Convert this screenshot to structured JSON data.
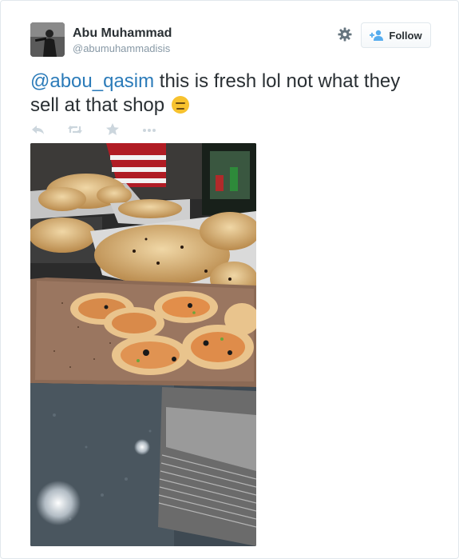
{
  "user": {
    "display_name": "Abu Muhammad",
    "handle": "@abumuhammadisis",
    "avatar_icon": "profile-photo"
  },
  "follow_button": {
    "label": "Follow",
    "icon": "add-user-icon"
  },
  "tweet": {
    "mention": "@abou_qasim",
    "text_line1": " this is fresh lol not what they",
    "text_line2": "sell at that shop",
    "emoji": "expressionless-face-emoji"
  },
  "actions": [
    "reply-icon",
    "retweet-icon",
    "favorite-icon",
    "more-icon"
  ],
  "colors": {
    "mention": "#2b7bb9",
    "icon_grey": "#ccd6dd",
    "text": "#292f33",
    "handle": "#8899a6",
    "follow_icon": "#55acee"
  }
}
